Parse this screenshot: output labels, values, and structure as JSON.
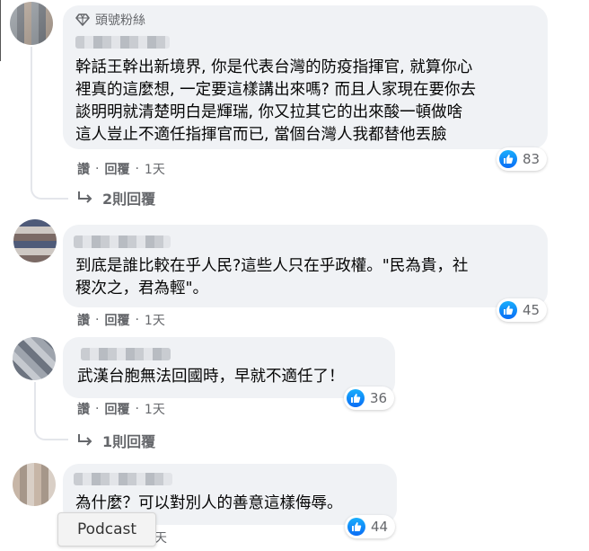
{
  "comments": [
    {
      "badge": "頭號粉絲",
      "lines": [
        "幹話王幹出新境界, 你是代表台灣的防疫指揮官, 就算你心",
        "裡真的這麼想, 一定要這樣講出來嗎? 而且人家現在要你去",
        "談明明就清楚明白是輝瑞, 你又拉其它的出來酸一頓做啥",
        "這人豈止不適任指揮官而已, 當個台灣人我都替他丟臉"
      ],
      "like": "讚",
      "reply": "回覆",
      "time": "1天",
      "reactions": "83",
      "replies": "2則回覆"
    },
    {
      "lines": [
        "到底是誰比較在乎人民?這些人只在乎政權。\"民為貴，社",
        "稷次之，君為輕\"。"
      ],
      "like": "讚",
      "reply": "回覆",
      "time": "1天",
      "reactions": "45"
    },
    {
      "lines": [
        "武漢台胞無法回國時，早就不適任了！"
      ],
      "like": "讚",
      "reply": "回覆",
      "time": "1天",
      "reactions": "36",
      "replies": "1則回覆"
    },
    {
      "lines": [
        "為什麼？可以對別人的善意這樣侮辱。"
      ],
      "time": "天",
      "reactions": "44"
    }
  ],
  "tooltip": "Podcast",
  "colors": {
    "bubble": "#f0f2f5",
    "meta_text": "#65676b",
    "like_blue": "#0a6cf5"
  },
  "icons": {
    "badge": "diamond-icon",
    "like": "thumbs-up-icon",
    "reply_arrow": "reply-arrow-icon"
  }
}
